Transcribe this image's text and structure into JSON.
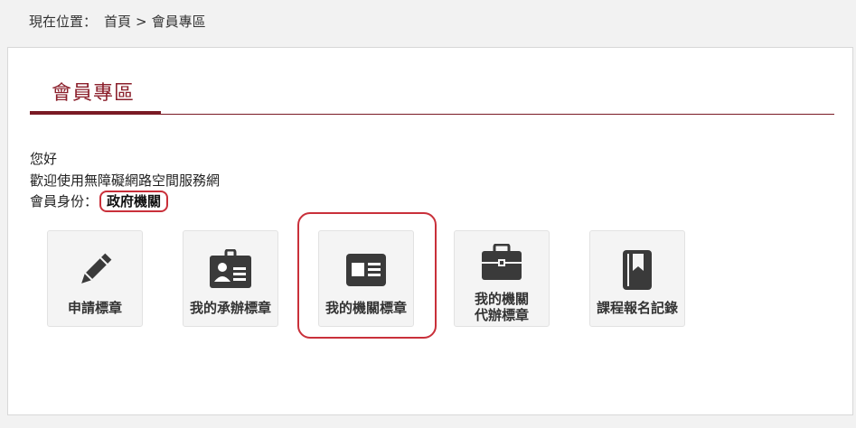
{
  "breadcrumb": {
    "prefix": "現在位置",
    "colon": "：",
    "home": "首頁",
    "separator": ">",
    "current": "會員專區"
  },
  "section": {
    "title": "會員專區"
  },
  "member": {
    "greeting": "您好",
    "welcome": "歡迎使用無障礙網路空間服務網",
    "identity_label": "會員身份",
    "identity_colon": "：",
    "identity_value": "政府機關"
  },
  "tiles": [
    {
      "label": "申請標章",
      "icon": "pencil-icon"
    },
    {
      "label": "我的承辦標章",
      "icon": "id-badge-icon"
    },
    {
      "label": "我的機關標章",
      "icon": "id-card-icon"
    },
    {
      "label": "我的機關\n代辦標章",
      "icon": "briefcase-icon"
    },
    {
      "label": "課程報名記錄",
      "icon": "notebook-icon"
    }
  ],
  "colors": {
    "accent": "#8b1f2b",
    "highlight": "#c9303a",
    "icon": "#3a3a3a"
  }
}
